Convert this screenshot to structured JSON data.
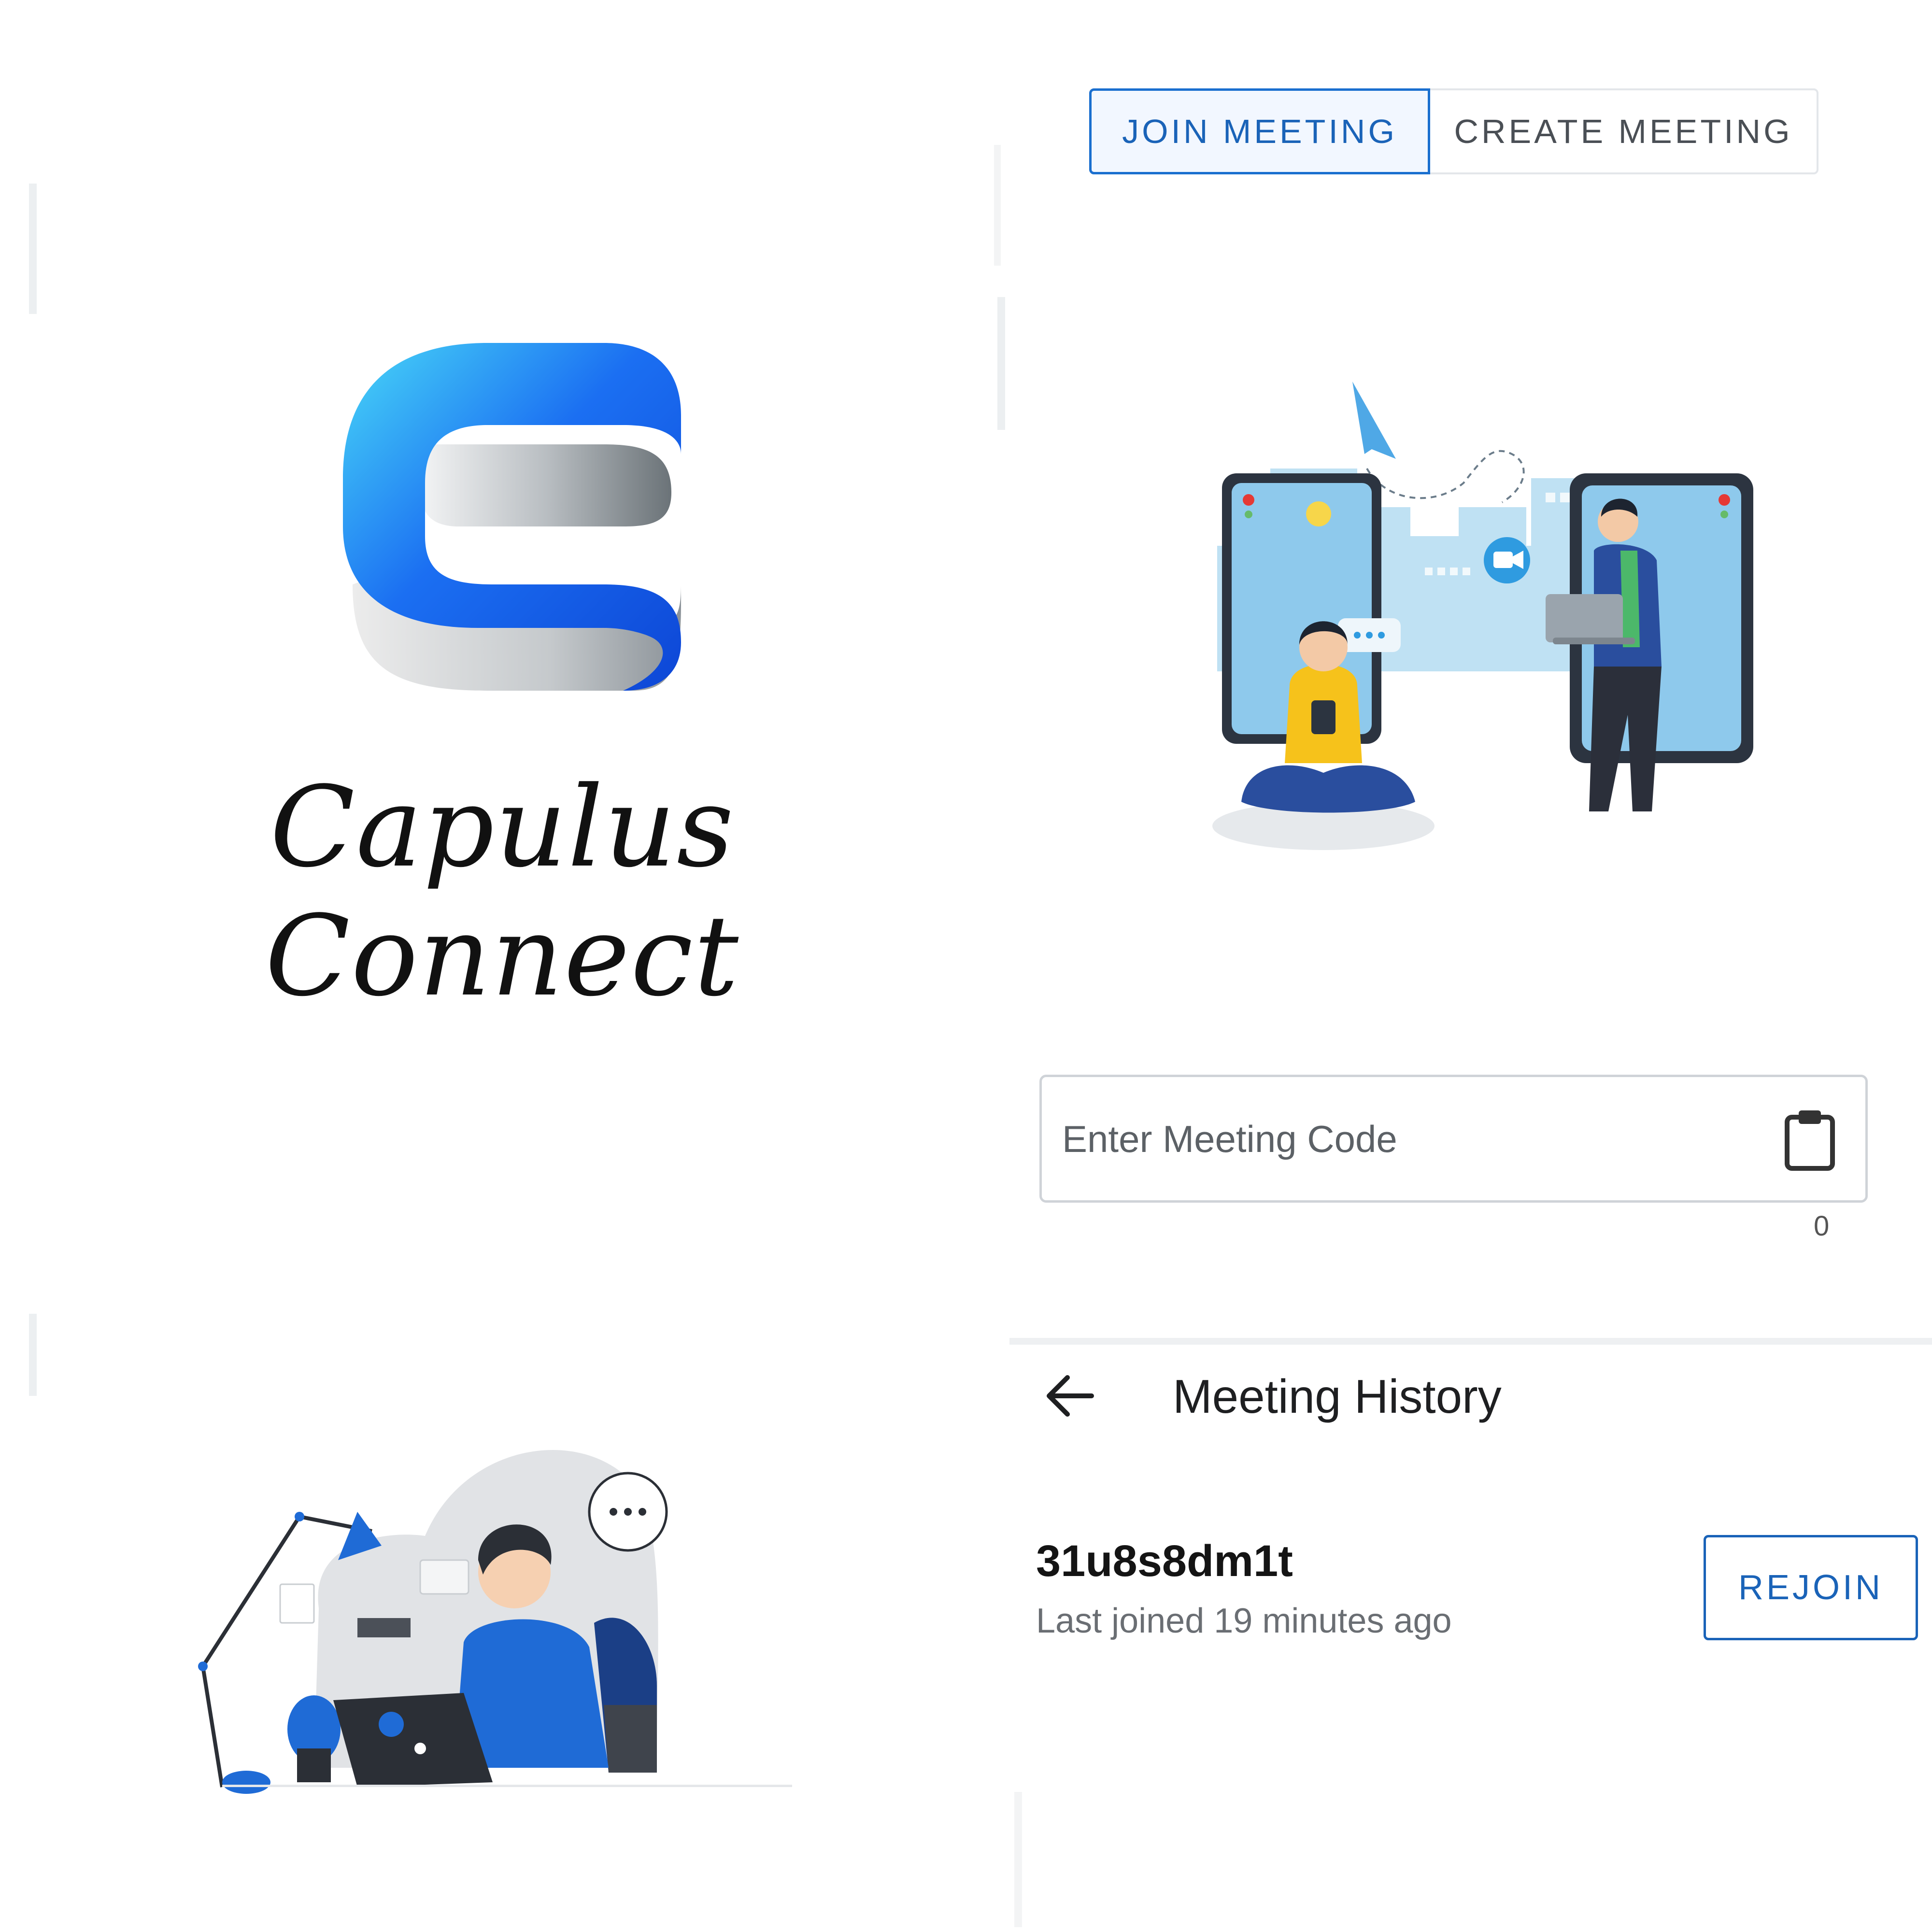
{
  "brand": {
    "name": "Capulus Connect",
    "logo_colors": [
      "#1f6bf0",
      "#3fd4f6",
      "#8a9198",
      "#d9dcde"
    ]
  },
  "tabs": [
    {
      "label": "JOIN MEETING",
      "selected": true
    },
    {
      "label": "CREATE MEETING",
      "selected": false
    }
  ],
  "join": {
    "placeholder": "Enter Meeting Code",
    "value": "",
    "counter": "0",
    "clipboard_icon": "clipboard-icon"
  },
  "history": {
    "title": "Meeting History",
    "back_icon": "arrow-left-icon",
    "items": [
      {
        "code": "31u8s8dm1t",
        "last_joined": "Last joined 19 minutes ago",
        "action": "REJOIN"
      }
    ]
  },
  "colors": {
    "accent": "#1a63b8",
    "tab_selected_bg": "#f2f7ff",
    "border": "#cfd3d8"
  }
}
